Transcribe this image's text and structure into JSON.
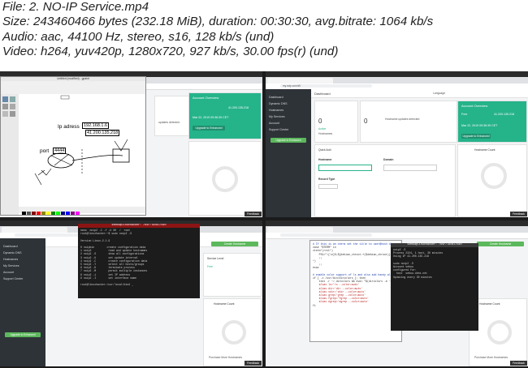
{
  "meta": {
    "file": "File: 2. NO-IP Service.mp4",
    "size": "Size: 243460466 bytes (232.18 MiB), duration: 00:30:30, avg.bitrate: 1064 kb/s",
    "audio": "Audio: aac, 44100 Hz, stereo, s16, 128 kb/s (und)",
    "video": "Video: h264, yuv420p, 1280x720, 927 kb/s, 30.00 fps(r) (und)"
  },
  "tile1": {
    "paint_title": "Untitled (modified) - gpaint",
    "note_ip": "Ip adress",
    "note_ip1": "192.168.1.6",
    "note_ip2": "41.200.135.218",
    "note_port": "port",
    "note_port_val": "4444",
    "account_title": "Account Overview",
    "ip_val": "41.200.135.218",
    "date_val": "Mar 22, 2019 09:36:39 CET",
    "upgrade": "Upgrade to Enhanced",
    "updates": "updates detected",
    "feedback": "Feedback"
  },
  "tile2": {
    "url": "my.noip.com/#!/",
    "dashboard": "Dashboard",
    "sidebar": [
      "Dashboard",
      "Dynamic DNS",
      "Hostnames",
      "My Services",
      "Account",
      "Support Center"
    ],
    "active_count": "0",
    "active_label": "Active",
    "hostnames_label": "Hostnames",
    "free": "Free",
    "hostname_updates": "Hostname updates detected",
    "account_title": "Account Overview",
    "ip_val": "41.200.135.218",
    "date_val": "Mar 22, 2019 09:36:39 CET",
    "quick_add": "Quick Add",
    "hostname_label": "Hostname",
    "domain_label": "Domain",
    "record_type": "Record Type",
    "hostname_count": "Hostname Count",
    "language": "Language",
    "upgrade": "Upgrade to Enhanced",
    "feedback": "Feedback"
  },
  "tile3": {
    "terminal_title": "sebou@linuxhacker: /usr/local/bin",
    "lines": [
      "nano  noip2 -C -Y -U 30  /  root",
      "root@linuxhacker:~$ sudo noip2 -S",
      "",
      "Version Linux-2.1.9",
      "",
      "0 noipbin        create configuration data",
      "1 noip2           read and update hostnames",
      "2 noip2 -S        show all configurations",
      "3 noip2 -U        set update interval",
      "4 noip2 -C        create configuration data",
      "5 noip2 -Y        select all hosts/groups",
      "6 noip2 -K        terminate process",
      "7 noip2 -M        permit multiple instances",
      "8 noip2 -i        set IP address",
      "9 noip2 -I        set interface name",
      "",
      "root@linuxhacker:/usr/local/bin# _"
    ],
    "service_level": "Service Level",
    "free": "Free",
    "create_hostname": "Create Hostname",
    "hostname_count": "Hostname Count",
    "purchase": "Purchase More Hostnames",
    "upgrade": "Upgrade to Enhanced",
    "feedback": "Feedback"
  },
  "tile4": {
    "editor_lines": [
      "# If this is an xterm set the title to user@host:dir",
      "case \"$TERM\" in",
      "xterm*|rxvt*)",
      "    PS1=\"\\[\\e]0;${debian_chroot:+($debian_chroot)}\\u@\\h: \\w\\a\\]$PS1\"",
      "    ;;",
      "*)",
      "    ;;",
      "esac",
      "",
      "# enable color support of ls and also add handy aliases",
      "if [ -x /usr/bin/dircolors ]; then",
      "    test -r ~/.dircolors && eval \"$(dircolors -b ~/.dircolors)\"",
      "    alias ls='ls --color=auto'",
      "    alias dir='dir --color=auto'",
      "    alias vdir='vdir --color=auto'",
      "    alias grep='grep --color=auto'",
      "    alias fgrep='fgrep --color=auto'",
      "    alias egrep='egrep --color=auto'",
      "fi"
    ],
    "terminal_title": "sebou@linuxhacker: /usr/local/bin",
    "term_lines": [
      "noip2 -S",
      "Process 2324, 1 host, 30 minutes",
      "Using IP 41.200.135.218",
      "",
      "sudo noip2 -S",
      "Account sebou",
      "configured for:",
      "  host  sebou.ddns.net",
      "Updating every 30 minutes"
    ],
    "create_hostname": "Create Hostname",
    "hostname_count": "Hostname Count",
    "purchase": "Purchase More Hostnames",
    "feedback": "Feedback"
  }
}
